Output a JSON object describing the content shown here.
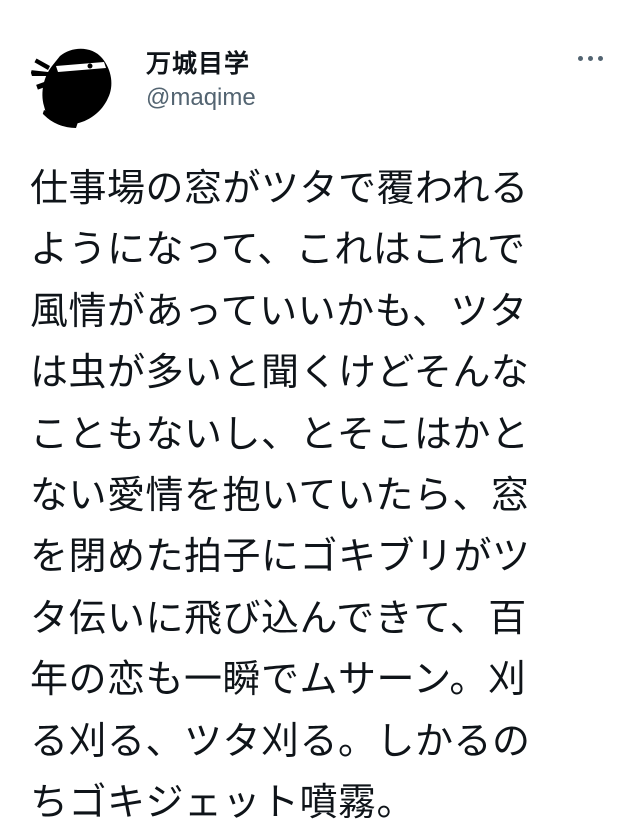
{
  "author": {
    "display_name": "万城目学",
    "handle": "@maqime",
    "avatar_icon": "ninja-avatar-icon"
  },
  "more_icon": "more-horizontal-icon",
  "tweet": {
    "lines": [
      "仕事場の窓がツタで覆われる",
      "ようになって、これはこれで",
      "風情があっていいかも、ツタ",
      "は虫が多いと聞くけどそんな",
      "こともないし、とそこはかと",
      "ない愛情を抱いていたら、窓",
      "を閉めた拍子にゴキブリがツ",
      "タ伝いに飛び込んできて、百",
      "年の恋も一瞬でムサーン。刈",
      "る刈る、ツタ刈る。しかるの",
      "ちゴキジェット噴霧。"
    ]
  },
  "colors": {
    "text": "#0f1419",
    "secondary": "#536471",
    "background": "#ffffff"
  }
}
